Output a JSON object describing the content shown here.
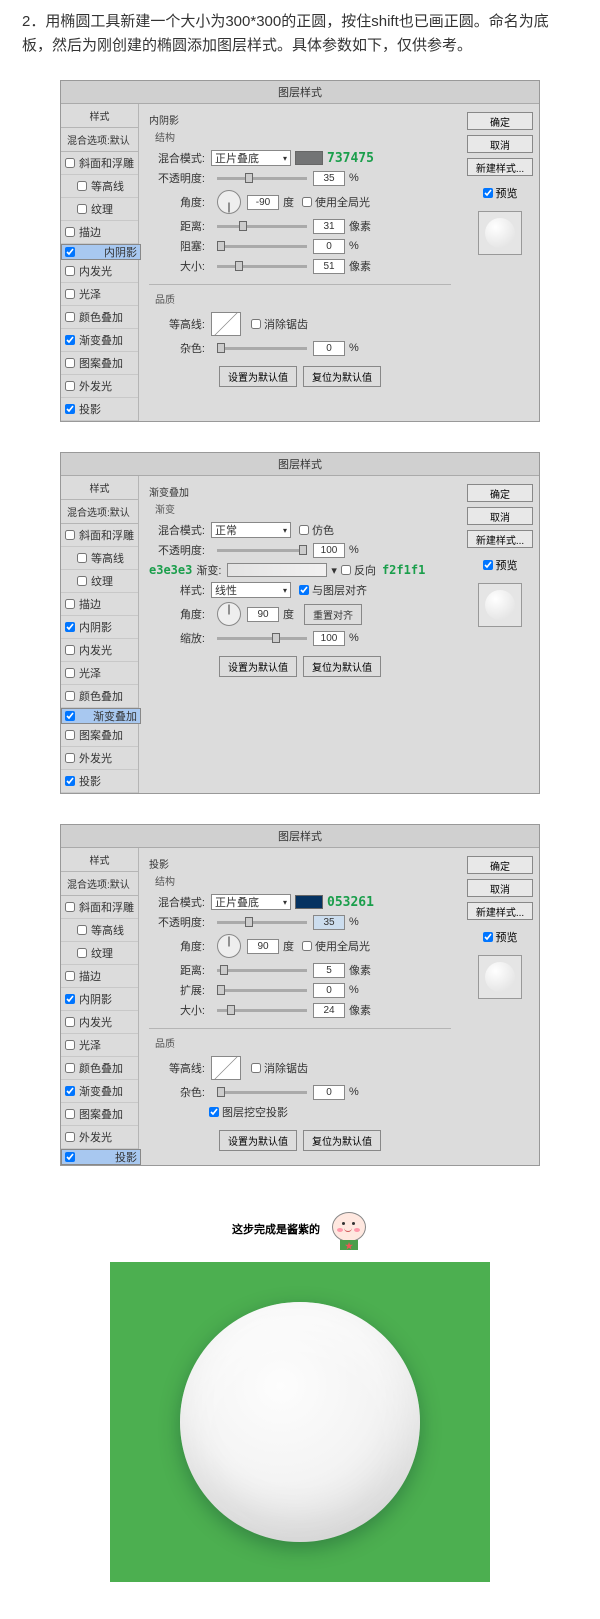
{
  "intro": "2．用椭圆工具新建一个大小为300*300的正圆，按住shift也已画正圆。命名为底板，然后为刚创建的椭圆添加图层样式。具体参数如下，仅供参考。",
  "dialog_title": "图层样式",
  "styles_header": "样式",
  "blend_options": "混合选项:默认",
  "style_items": [
    "斜面和浮雕",
    "等高线",
    "纹理",
    "描边",
    "内阴影",
    "内发光",
    "光泽",
    "颜色叠加",
    "渐变叠加",
    "图案叠加",
    "外发光",
    "投影"
  ],
  "buttons": {
    "ok": "确定",
    "cancel": "取消",
    "new": "新建样式...",
    "preview": "预览",
    "default": "设置为默认值",
    "reset": "复位为默认值",
    "realign": "重置对齐"
  },
  "d1": {
    "title": "内阴影",
    "group": "结构",
    "blend_mode": "混合模式:",
    "blend_val": "正片叠底",
    "hex": "737475",
    "opacity": "不透明度:",
    "opacity_v": "35",
    "angle": "角度:",
    "angle_v": "-90",
    "deg": "度",
    "global": "使用全局光",
    "distance": "距离:",
    "distance_v": "31",
    "px": "像素",
    "choke": "阻塞:",
    "choke_v": "0",
    "size": "大小:",
    "size_v": "51",
    "quality": "品质",
    "contour": "等高线:",
    "anti": "消除锯齿",
    "noise": "杂色:",
    "noise_v": "0"
  },
  "d2": {
    "title": "渐变叠加",
    "group": "渐变",
    "blend_mode": "混合模式:",
    "blend_val": "正常",
    "dither": "仿色",
    "opacity": "不透明度:",
    "opacity_v": "100",
    "gradient": "渐变:",
    "reverse": "反向",
    "hex1": "e3e3e3",
    "hex2": "f2f1f1",
    "style": "样式:",
    "style_v": "线性",
    "align": "与图层对齐",
    "angle": "角度:",
    "angle_v": "90",
    "deg": "度",
    "scale": "缩放:",
    "scale_v": "100"
  },
  "d3": {
    "title": "投影",
    "group": "结构",
    "blend_mode": "混合模式:",
    "blend_val": "正片叠底",
    "hex": "053261",
    "opacity": "不透明度:",
    "opacity_v": "35",
    "angle": "角度:",
    "angle_v": "90",
    "deg": "度",
    "global": "使用全局光",
    "distance": "距离:",
    "distance_v": "5",
    "px": "像素",
    "spread": "扩展:",
    "spread_v": "0",
    "size": "大小:",
    "size_v": "24",
    "quality": "品质",
    "contour": "等高线:",
    "anti": "消除锯齿",
    "noise": "杂色:",
    "noise_v": "0",
    "knockout": "图层挖空投影"
  },
  "caption": "这步完成是酱紫的"
}
